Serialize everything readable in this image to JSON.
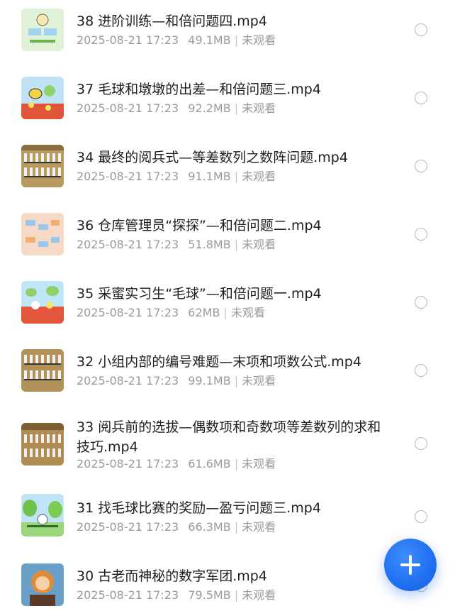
{
  "items": [
    {
      "title": "38 进阶训练—和倍问题四.mp4",
      "date": "2025-08-21 17:23",
      "size": "49.1MB",
      "status": "未观看",
      "thumb_icon": "math-lesson-thumbnail"
    },
    {
      "title": "37 毛球和墩墩的出差—和倍问题三.mp4",
      "date": "2025-08-21 17:23",
      "size": "92.2MB",
      "status": "未观看",
      "thumb_icon": "bee-cartoon-thumbnail"
    },
    {
      "title": "34 最终的阅兵式—等差数列之数阵问题.mp4",
      "date": "2025-08-21 17:23",
      "size": "91.1MB",
      "status": "未观看",
      "thumb_icon": "soldiers-thumbnail"
    },
    {
      "title": "36 仓库管理员“探探”—和倍问题二.mp4",
      "date": "2025-08-21 17:23",
      "size": "51.8MB",
      "status": "未观看",
      "thumb_icon": "warehouse-thumbnail"
    },
    {
      "title": "35 采蜜实习生“毛球”—和倍问题一.mp4",
      "date": "2025-08-21 17:23",
      "size": "62MB",
      "status": "未观看",
      "thumb_icon": "flowers-thumbnail"
    },
    {
      "title": "32 小组内部的编号难题—末项和项数公式.mp4",
      "date": "2025-08-21 17:23",
      "size": "99.1MB",
      "status": "未观看",
      "thumb_icon": "soldiers-thumbnail"
    },
    {
      "title": "33 阅兵前的选拔—偶数项和奇数项等差数列的求和技巧.mp4",
      "date": "2025-08-21 17:23",
      "size": "61.6MB",
      "status": "未观看",
      "thumb_icon": "soldiers-thumbnail"
    },
    {
      "title": "31 找毛球比赛的奖励—盈亏问题三.mp4",
      "date": "2025-08-21 17:23",
      "size": "66.3MB",
      "status": "未观看",
      "thumb_icon": "forest-thumbnail"
    },
    {
      "title": "30 古老而神秘的数字军团.mp4",
      "date": "2025-08-21 17:23",
      "size": "79.5MB",
      "status": "未观看",
      "thumb_icon": "character-thumbnail"
    }
  ],
  "fab_icon": "plus-icon",
  "colors": {
    "accent": "#1f6ff0",
    "meta": "#9a9a9a"
  }
}
